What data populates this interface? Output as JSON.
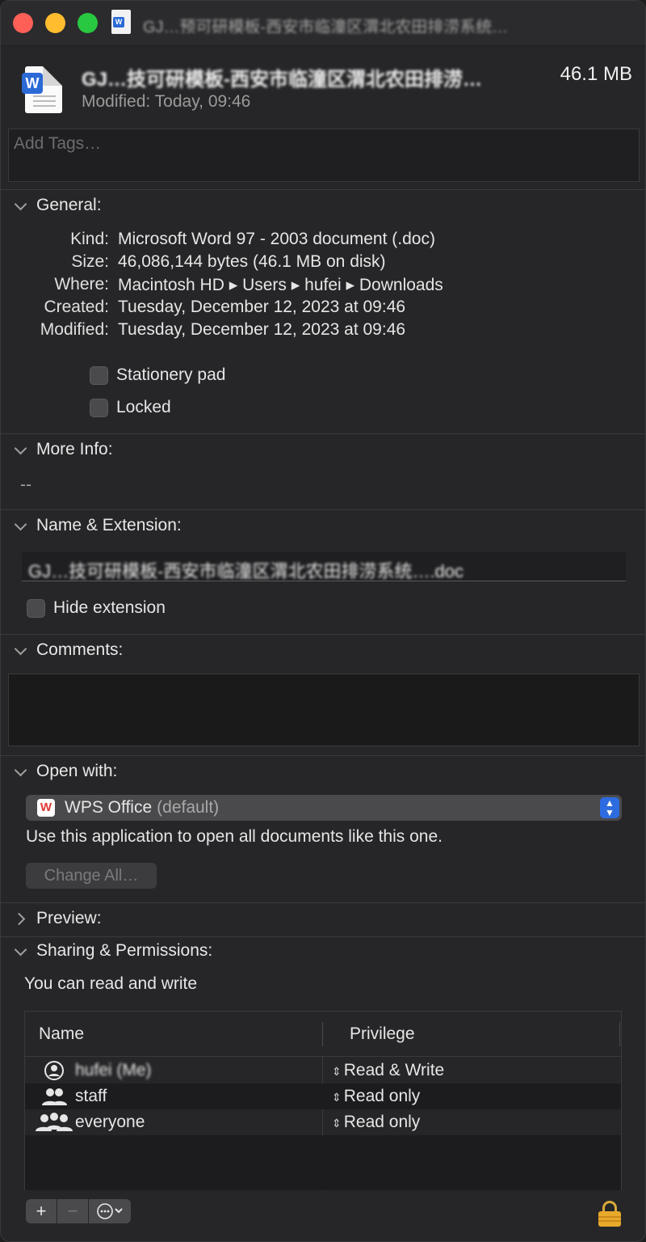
{
  "window": {
    "title": "GJ…预可研模板-西安市临潼区渭北农田排涝系统…",
    "file_name": "GJ…技可研模板-西安市临潼区渭北农田排涝…",
    "size": "46.1 MB",
    "modified_short": "Modified: Today, 09:46"
  },
  "tags": {
    "placeholder": "Add Tags…"
  },
  "general": {
    "heading": "General:",
    "rows": [
      {
        "key": "Kind:",
        "value": "Microsoft Word 97 - 2003 document (.doc)"
      },
      {
        "key": "Size:",
        "value": "46,086,144 bytes (46.1 MB on disk)"
      },
      {
        "key": "Where:",
        "value": "Macintosh HD ▸ Users ▸ hufei ▸ Downloads"
      },
      {
        "key": "Created:",
        "value": "Tuesday, December 12, 2023 at 09:46"
      },
      {
        "key": "Modified:",
        "value": "Tuesday, December 12, 2023 at 09:46"
      }
    ],
    "stationery_label": "Stationery pad",
    "locked_label": "Locked"
  },
  "more_info": {
    "heading": "More Info:",
    "value": "--"
  },
  "name_ext": {
    "heading": "Name & Extension:",
    "name_value": "GJ…技可研模板-西安市临潼区渭北农田排涝系统….doc",
    "hide_ext_label": "Hide extension"
  },
  "comments": {
    "heading": "Comments:"
  },
  "open_with": {
    "heading": "Open with:",
    "app": "WPS Office",
    "app_suffix": "(default)",
    "hint": "Use this application to open all documents like this one.",
    "change_all": "Change All…"
  },
  "preview": {
    "heading": "Preview:"
  },
  "sharing": {
    "heading": "Sharing & Permissions:",
    "status": "You can read and write",
    "col_name": "Name",
    "col_privilege": "Privilege",
    "rows": [
      {
        "name": "hufei (Me)",
        "privilege": "Read & Write",
        "icon": "user-icon"
      },
      {
        "name": "staff",
        "privilege": "Read only",
        "icon": "group-icon"
      },
      {
        "name": "everyone",
        "privilege": "Read only",
        "icon": "everyone-icon"
      }
    ]
  },
  "colors": {
    "accent": "#2d6be0",
    "lock": "#e8a92b",
    "wps_red": "#e53935"
  }
}
